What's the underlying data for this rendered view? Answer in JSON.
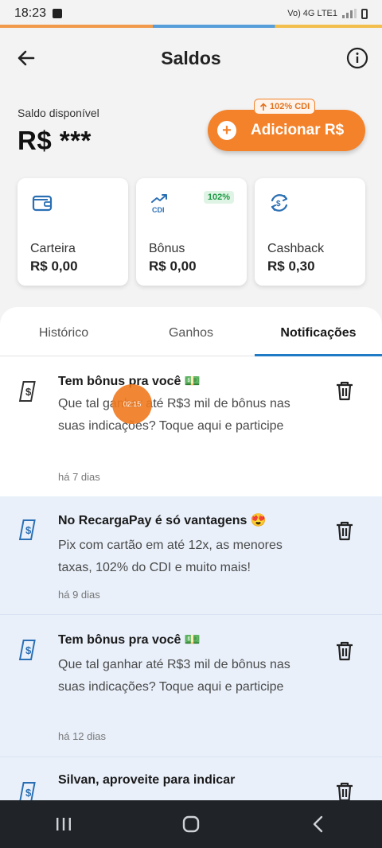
{
  "status_bar": {
    "time": "18:23",
    "net": "Vo) 4G LTE1"
  },
  "header": {
    "title": "Saldos"
  },
  "balance": {
    "label": "Saldo disponível",
    "value": "R$ ***"
  },
  "add_button": {
    "label": "Adicionar R$",
    "badge": "102% CDI"
  },
  "cards": [
    {
      "title": "Carteira",
      "value": "R$ 0,00",
      "icon": "wallet-icon"
    },
    {
      "title": "Bônus",
      "value": "R$ 0,00",
      "icon": "cdi-trend-icon",
      "pill": "102%"
    },
    {
      "title": "Cashback",
      "value": "R$ 0,30",
      "icon": "cashback-icon"
    }
  ],
  "tabs": [
    {
      "label": "Histórico"
    },
    {
      "label": "Ganhos"
    },
    {
      "label": "Notificações",
      "active": true
    }
  ],
  "notifications": [
    {
      "title": "Tem bônus pra você 💵",
      "body": "Que tal ganhar até R$3 mil de bônus nas suas indicações? Toque aqui e participe",
      "time": "há 7 dias",
      "tinted": false
    },
    {
      "title": "No RecargaPay é só vantagens 😍",
      "body": "Pix com cartão em até 12x, as menores taxas, 102% do CDI e muito mais!",
      "time": "há 9 dias",
      "tinted": true
    },
    {
      "title": "Tem bônus pra você 💵",
      "body": "Que tal ganhar até R$3 mil de bônus nas suas indicações? Toque aqui e participe",
      "time": "há 12 dias",
      "tinted": true
    },
    {
      "title": "Silvan, aproveite para indicar",
      "body": "",
      "time": "",
      "tinted": true
    }
  ],
  "recording_indicator": {
    "label": "02:15"
  },
  "colors": {
    "accent": "#f3822a",
    "tab_indicator": "#1f7bc6",
    "icon_blue": "#2a6fb4"
  }
}
